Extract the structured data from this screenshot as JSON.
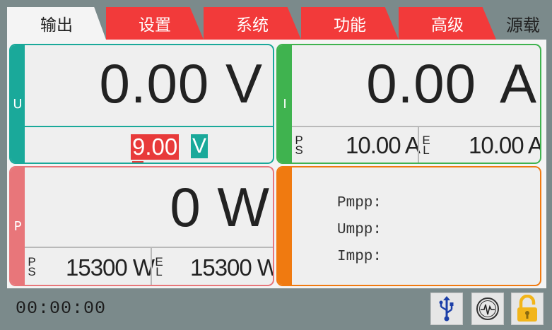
{
  "tabs": [
    {
      "label": "输出",
      "active": true
    },
    {
      "label": "设置",
      "active": false
    },
    {
      "label": "系统",
      "active": false
    },
    {
      "label": "功能",
      "active": false
    },
    {
      "label": "高级",
      "active": false
    }
  ],
  "source_label": "源载",
  "voltage": {
    "side_label": "U",
    "value": "0.00 V",
    "set_value": "9.00",
    "set_unit": "V",
    "color": "#1aa99a"
  },
  "current": {
    "side_label": "I",
    "value": "0.00",
    "unit": "A",
    "ps_label": [
      "P",
      "S"
    ],
    "ps_value": "10.00 A",
    "el_label": [
      "E",
      "L"
    ],
    "el_value": "10.00 A",
    "color": "#3fb34f"
  },
  "power": {
    "side_label": "P",
    "value": "0 W",
    "ps_label": [
      "P",
      "S"
    ],
    "ps_value": "15300 W",
    "el_label": [
      "E",
      "L"
    ],
    "el_value": "15300 W",
    "color": "#e8767a"
  },
  "mpp": {
    "color": "#f07a10",
    "labels": [
      "Pmpp:",
      "Umpp:",
      "Impp:"
    ]
  },
  "status_bar": {
    "timer": "00:00:00",
    "icons": [
      "usb-icon",
      "waveform-icon",
      "lock-open-icon"
    ]
  },
  "colors": {
    "frame": "#7b8a8b",
    "tab_red": "#f23a3a",
    "lock": "#f2b51a",
    "usb": "#1c3fa8"
  }
}
